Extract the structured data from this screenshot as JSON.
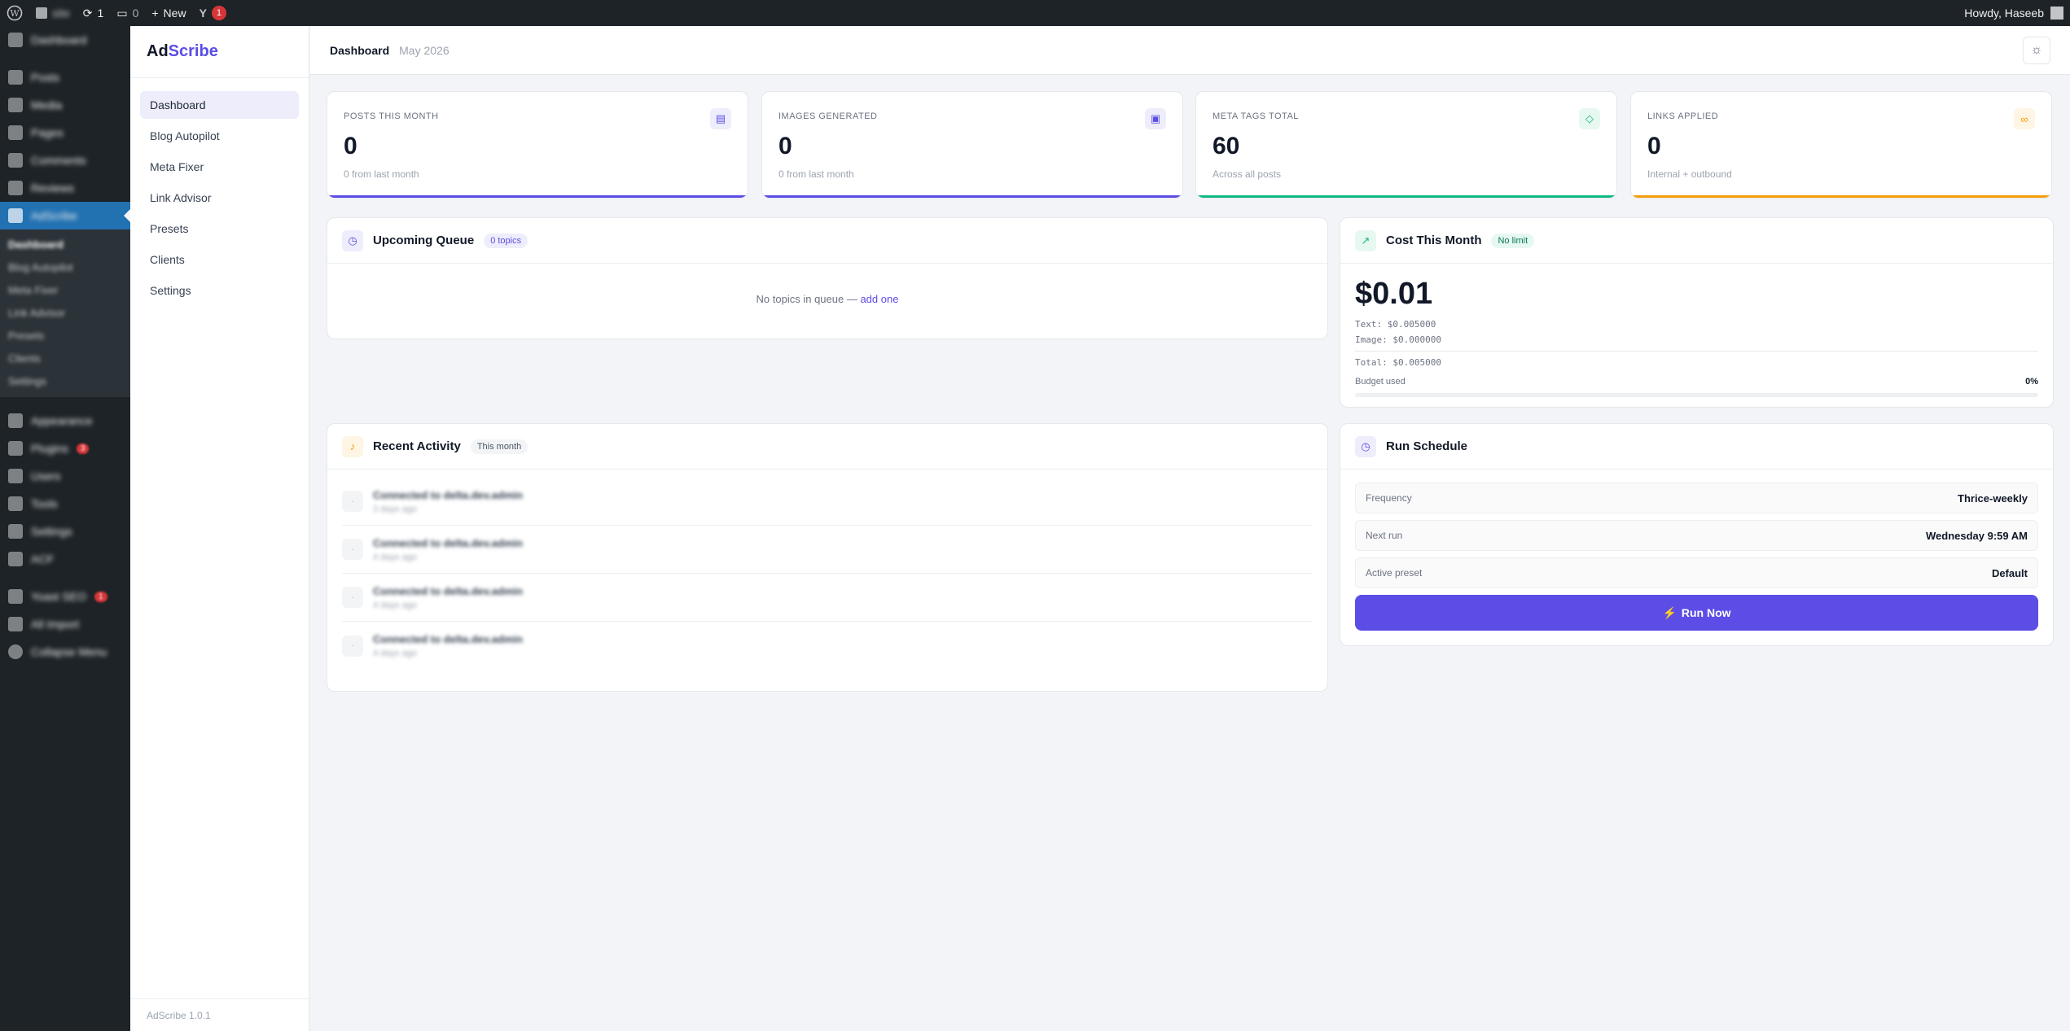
{
  "admin_bar": {
    "site_name": "site",
    "updates_count": "1",
    "comments_count": "0",
    "new_label": "New",
    "yoast_badge": "1",
    "howdy": "Howdy, Haseeb"
  },
  "wp_menu": {
    "items_top": [
      "Dashboard"
    ],
    "items_mid": [
      "Posts",
      "Media",
      "Pages",
      "Comments",
      "Reviews"
    ],
    "active": "AdScribe",
    "submenu": [
      "Dashboard",
      "Blog Autopilot",
      "Meta Fixer",
      "Link Advisor",
      "Presets",
      "Clients",
      "Settings"
    ],
    "items_bottom": [
      "Appearance",
      "Plugins",
      "Users",
      "Tools",
      "Settings",
      "ACF"
    ],
    "plugins_badge": "3",
    "items_extra": [
      "Yoast SEO",
      "All Import",
      "Collapse Menu"
    ],
    "yoast_badge": "1"
  },
  "sidebar": {
    "brand_prefix": "Ad",
    "brand_suffix": "Scribe",
    "items": [
      "Dashboard",
      "Blog Autopilot",
      "Meta Fixer",
      "Link Advisor",
      "Presets",
      "Clients",
      "Settings"
    ],
    "active_item": "Dashboard",
    "version": "AdScribe 1.0.1"
  },
  "header": {
    "title": "Dashboard",
    "month": "May 2026"
  },
  "stats": [
    {
      "label": "POSTS THIS MONTH",
      "value": "0",
      "sub": "0 from last month",
      "icon": "document-icon",
      "color": "#5b4de6"
    },
    {
      "label": "IMAGES GENERATED",
      "value": "0",
      "sub": "0 from last month",
      "icon": "image-icon",
      "color": "#5b4de6"
    },
    {
      "label": "META TAGS TOTAL",
      "value": "60",
      "sub": "Across all posts",
      "icon": "tag-icon",
      "color": "#10b981"
    },
    {
      "label": "LINKS APPLIED",
      "value": "0",
      "sub": "Internal + outbound",
      "icon": "link-icon",
      "color": "#f59e0b"
    }
  ],
  "queue": {
    "title": "Upcoming Queue",
    "badge": "0 topics",
    "empty_text": "No topics in queue —",
    "add_link": "add one"
  },
  "cost": {
    "title": "Cost This Month",
    "badge": "No limit",
    "value": "$0.01",
    "text_line": "Text:  $0.005000",
    "image_line": "Image: $0.000000",
    "total_line": "Total: $0.005000",
    "budget_label": "Budget used",
    "budget_percent_text": "0%",
    "budget_fraction": 0
  },
  "activity": {
    "title": "Recent Activity",
    "badge": "This month",
    "items": [
      {
        "text": "Connected to delta.dev.admin",
        "time": "3 days ago"
      },
      {
        "text": "Connected to delta.dev.admin",
        "time": "4 days ago"
      },
      {
        "text": "Connected to delta.dev.admin",
        "time": "4 days ago"
      },
      {
        "text": "Connected to delta.dev.admin",
        "time": "4 days ago"
      }
    ]
  },
  "schedule": {
    "title": "Run Schedule",
    "rows": [
      {
        "label": "Frequency",
        "value": "Thrice-weekly"
      },
      {
        "label": "Next run",
        "value": "Wednesday 9:59 AM"
      },
      {
        "label": "Active preset",
        "value": "Default"
      }
    ],
    "run_label": "Run Now"
  }
}
